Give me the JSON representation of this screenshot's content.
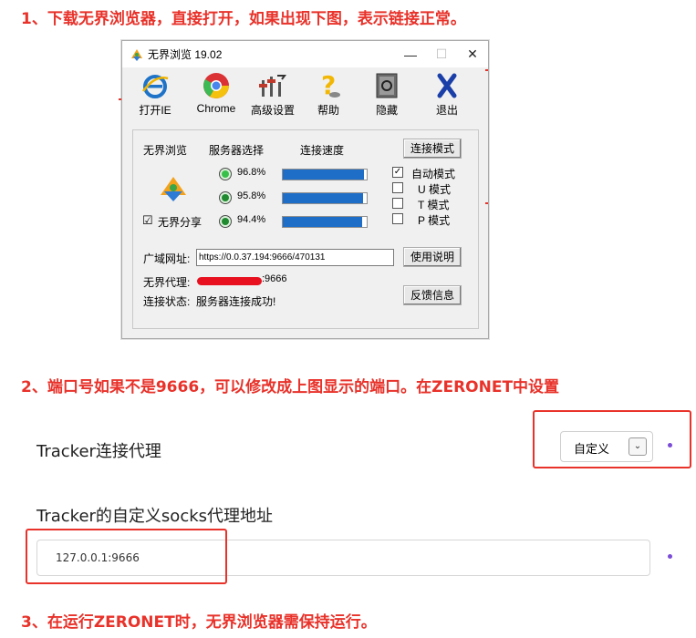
{
  "steps": {
    "step1": "1、下载无界浏览器，直接打开，如果出现下图，表示链接正常。",
    "step2": "2、端口号如果不是9666，可以修改成上图显示的端口。在ZERONET中设置",
    "step3": "3、在运行ZERONET时，无界浏览器需保持运行。"
  },
  "window": {
    "title": "无界浏览 19.02",
    "minimize": "—",
    "maximize": "☐",
    "close": "✕"
  },
  "toolbar": {
    "items": [
      {
        "label": "打开IE",
        "icon": "ie-icon"
      },
      {
        "label": "Chrome",
        "icon": "chrome-icon"
      },
      {
        "label": "高级设置",
        "icon": "advanced-settings-icon"
      },
      {
        "label": "帮助",
        "icon": "help-icon"
      },
      {
        "label": "隐藏",
        "icon": "hide-safe-icon"
      },
      {
        "label": "退出",
        "icon": "exit-x-icon"
      }
    ]
  },
  "panel": {
    "col_browser": "无界浏览",
    "col_server": "服务器选择",
    "col_speed": "连接速度",
    "mode_button": "连接模式",
    "servers": [
      {
        "percent": "96.8%",
        "value": 0.968,
        "active": true
      },
      {
        "percent": "95.8%",
        "value": 0.958,
        "active": false
      },
      {
        "percent": "94.4%",
        "value": 0.944,
        "active": false
      }
    ],
    "modes": [
      {
        "label": "自动模式",
        "checked": true
      },
      {
        "label": "U 模式",
        "checked": false
      },
      {
        "label": "T 模式",
        "checked": false
      },
      {
        "label": "P 模式",
        "checked": false
      }
    ],
    "share_label": "无界分享",
    "share_checked": "☑",
    "url_label": "广域网址:",
    "url_value": "https://0.0.37.194:9666/470131",
    "usage_button": "使用说明",
    "proxy_label": "无界代理:",
    "proxy_port": ":9666",
    "status_label": "连接状态:",
    "status_value": "服务器连接成功!",
    "feedback_button": "反馈信息"
  },
  "settings": {
    "tracker_proxy_label": "Tracker连接代理",
    "tracker_proxy_value": "自定义",
    "tracker_socks_label": "Tracker的自定义socks代理地址",
    "tracker_socks_value": "127.0.0.1:9666"
  },
  "colors": {
    "annotation_red": "#e8322a",
    "speed_bar": "#1e6ec8",
    "accent_purple": "#7b4cd6"
  }
}
